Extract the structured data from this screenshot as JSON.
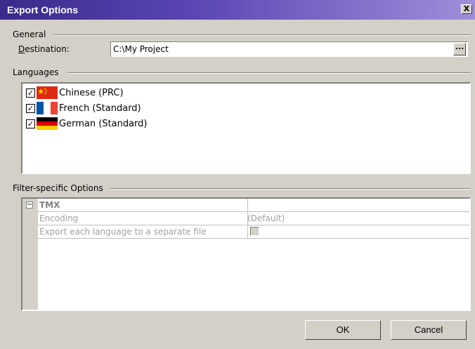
{
  "window": {
    "title": "Export Options",
    "close_symbol": "X"
  },
  "general": {
    "group_label": "General",
    "destination_label": "Destination:",
    "destination_value": "C:\\My Project",
    "browse_label": "..."
  },
  "languages": {
    "group_label": "Languages",
    "items": [
      {
        "label": "Chinese (PRC)",
        "checked": true,
        "flag": "flag-china-icon"
      },
      {
        "label": "French (Standard)",
        "checked": true,
        "flag": "flag-france-icon"
      },
      {
        "label": "German (Standard)",
        "checked": true,
        "flag": "flag-germany-icon"
      }
    ]
  },
  "filter": {
    "group_label": "Filter-specific Options",
    "category": "TMX",
    "expander_symbol": "−",
    "rows": [
      {
        "name": "Encoding",
        "value": "(Default)"
      },
      {
        "name": "Export each language to a separate file",
        "value": ""
      }
    ]
  },
  "buttons": {
    "ok": "OK",
    "cancel": "Cancel"
  },
  "colors": {
    "title_start": "#3a2a8a",
    "title_end": "#9f8fda",
    "face": "#d4d0c8"
  }
}
